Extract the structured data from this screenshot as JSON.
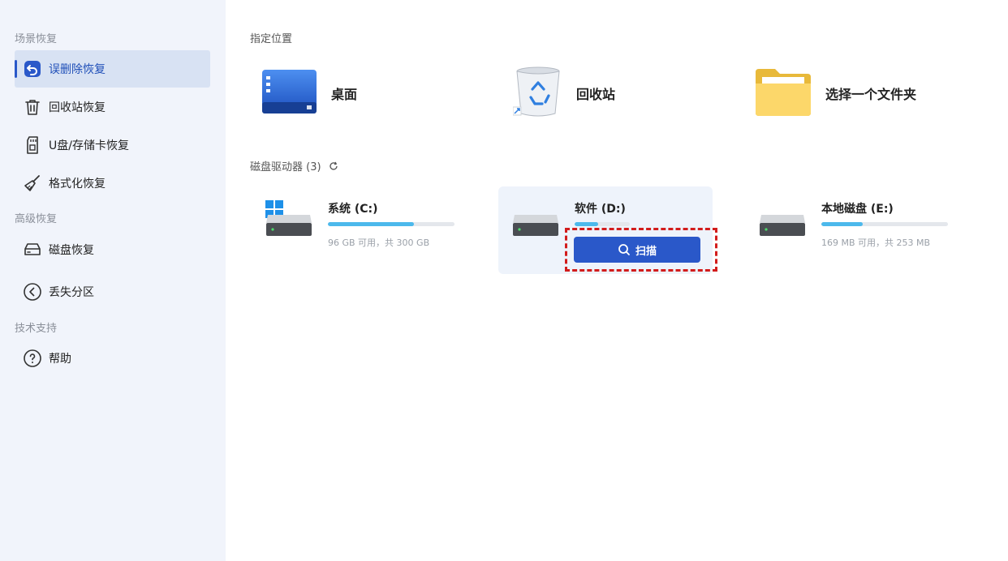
{
  "sidebar": {
    "sections": [
      {
        "title": "场景恢复"
      },
      {
        "title": "高级恢复"
      },
      {
        "title": "技术支持"
      }
    ],
    "items": [
      {
        "label": "误删除恢复",
        "icon": "undo-icon"
      },
      {
        "label": "回收站恢复",
        "icon": "trash-icon"
      },
      {
        "label": "U盘/存储卡恢复",
        "icon": "sd-card-icon"
      },
      {
        "label": "格式化恢复",
        "icon": "broom-icon"
      },
      {
        "label": "磁盘恢复",
        "icon": "hard-drive-icon"
      },
      {
        "label": "丢失分区",
        "icon": "partition-icon"
      },
      {
        "label": "帮助",
        "icon": "help-icon"
      }
    ],
    "active_item": "误删除恢复"
  },
  "main": {
    "locations_title": "指定位置",
    "locations": [
      {
        "label": "桌面",
        "icon": "desktop-icon"
      },
      {
        "label": "回收站",
        "icon": "recycle-bin-icon"
      },
      {
        "label": "选择一个文件夹",
        "icon": "folder-icon"
      }
    ],
    "drives_title": "磁盘驱动器 (3)",
    "refresh_icon": "refresh-icon",
    "drives": [
      {
        "name": "系统 (C:)",
        "info": "96 GB 可用，共 300 GB",
        "used_fraction": 0.68
      },
      {
        "name": "软件 (D:)",
        "info": "",
        "used_fraction": 0.43
      },
      {
        "name": "本地磁盘 (E:)",
        "info": "169 MB 可用，共 253 MB",
        "used_fraction": 0.33
      }
    ],
    "scan_button": "扫描"
  },
  "colors": {
    "accent": "#2a58c9",
    "bar_fill": "#4cb9ec",
    "highlight": "#d21c1c"
  }
}
